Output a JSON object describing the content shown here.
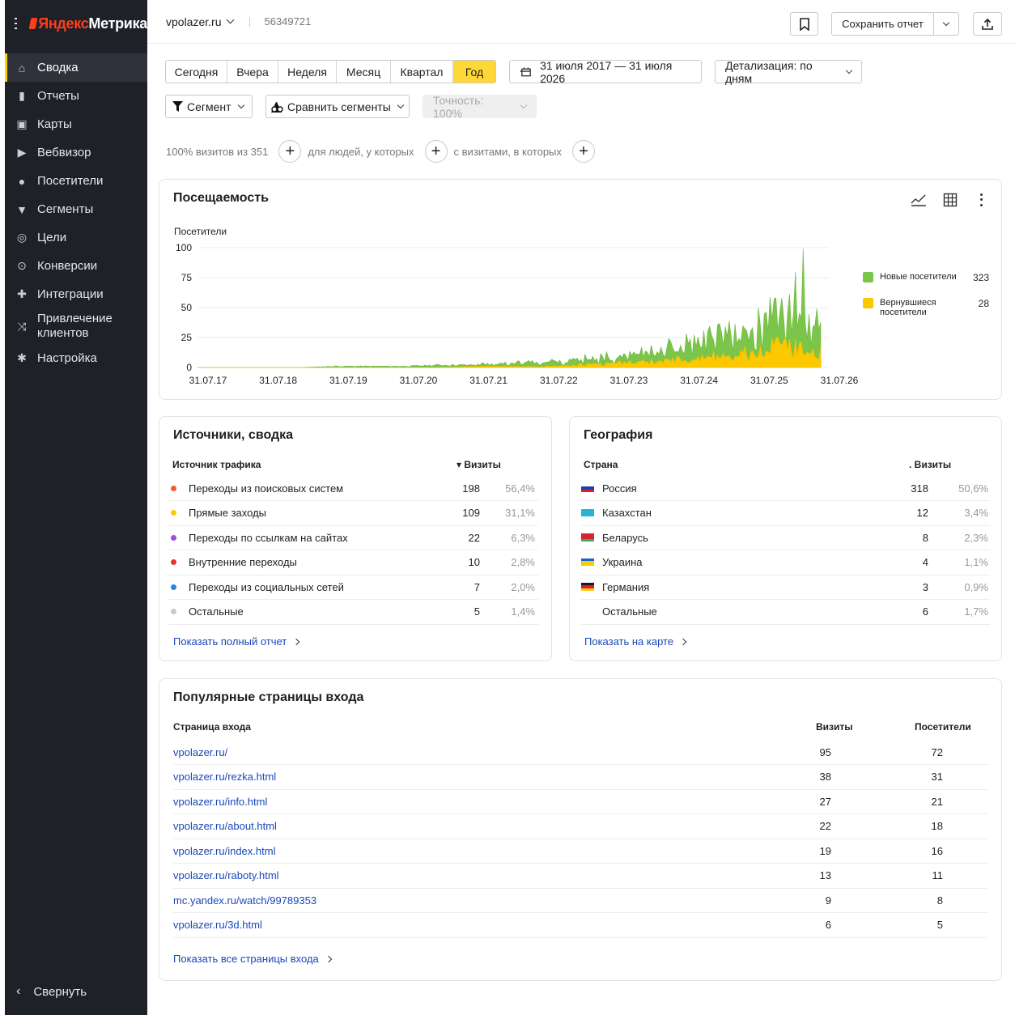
{
  "app": {
    "logo_ya": "Яндекс",
    "logo_rest": " Метрика"
  },
  "sidebar": {
    "items": [
      {
        "label": "Сводка",
        "icon": "home-icon",
        "active": true
      },
      {
        "label": "Отчеты",
        "icon": "bar-chart-icon"
      },
      {
        "label": "Карты",
        "icon": "map-icon"
      },
      {
        "label": "Вебвизор",
        "icon": "play-icon"
      },
      {
        "label": "Посетители",
        "icon": "user-icon"
      },
      {
        "label": "Сегменты",
        "icon": "funnel-icon"
      },
      {
        "label": "Цели",
        "icon": "target-icon"
      },
      {
        "label": "Конверсии",
        "icon": "conversion-icon"
      },
      {
        "label": "Интеграции",
        "icon": "puzzle-icon"
      },
      {
        "label": "Привлечение клиентов",
        "icon": "share-icon"
      },
      {
        "label": "Настройка",
        "icon": "gear-icon"
      }
    ],
    "collapse_label": "Свернуть"
  },
  "header": {
    "site": "vpolazer.ru",
    "counter_id": "56349721",
    "save_report": "Сохранить отчет"
  },
  "toolbar": {
    "periods": [
      "Сегодня",
      "Вчера",
      "Неделя",
      "Месяц",
      "Квартал",
      "Год"
    ],
    "active_period": "Год",
    "date_range": "31 июля 2017 — 31 июля 2026",
    "detail": "Детализация: по дням",
    "segment": "Сегмент",
    "compare": "Сравнить сегменты",
    "accuracy": "Точность: 100%"
  },
  "filters": {
    "visits_text": "100% визитов из 351",
    "people_text": "для людей, у которых",
    "visits_with_text": "с визитами, в которых"
  },
  "traffic": {
    "title": "Посещаемость",
    "ylabel": "Посетители",
    "legend": [
      {
        "name": "Новые посетители",
        "value": "323",
        "color": "#7bc54a"
      },
      {
        "name": "Вернувшиеся посетители",
        "value": "28",
        "color": "#fcc800"
      }
    ]
  },
  "chart_data": {
    "type": "area",
    "title": "Посещаемость",
    "ylabel": "Посетители",
    "ylim": [
      0,
      100
    ],
    "yticks": [
      0,
      25,
      50,
      75,
      100
    ],
    "xticks": [
      "31.07.17",
      "31.07.18",
      "31.07.19",
      "31.07.20",
      "31.07.21",
      "31.07.22",
      "31.07.23",
      "31.07.24",
      "31.07.25",
      "31.07.26"
    ],
    "stacked": false,
    "x": [
      "31.07.17",
      "31.12.17",
      "31.07.18",
      "31.12.18",
      "31.07.19",
      "31.12.19",
      "31.07.20",
      "31.12.20",
      "31.07.21",
      "31.12.21",
      "31.07.22",
      "31.12.22",
      "31.07.23",
      "31.12.23",
      "31.07.24",
      "31.12.24",
      "31.07.25",
      "31.12.25",
      "31.07.26"
    ],
    "series": [
      {
        "name": "Новые посетители",
        "color": "#7bc54a",
        "values": [
          0,
          0,
          0,
          0,
          1,
          1,
          1,
          2,
          2,
          3,
          4,
          5,
          8,
          11,
          15,
          20,
          25,
          45,
          25
        ]
      },
      {
        "name": "Вернувшиеся посетители",
        "color": "#fcc800",
        "values": [
          0,
          0,
          0,
          0,
          0,
          0,
          0,
          0,
          1,
          1,
          1,
          2,
          3,
          4,
          6,
          8,
          10,
          18,
          10
        ]
      }
    ]
  },
  "sources": {
    "title": "Источники, сводка",
    "col_source": "Источник трафика",
    "col_visits": "▾ Визиты",
    "rows": [
      {
        "name": "Переходы из поисковых систем",
        "visits": "198",
        "pct": "56,4%",
        "color": "#f55a2c"
      },
      {
        "name": "Прямые заходы",
        "visits": "109",
        "pct": "31,1%",
        "color": "#fcc800"
      },
      {
        "name": "Переходы по ссылкам на сайтах",
        "visits": "22",
        "pct": "6,3%",
        "color": "#a24be0"
      },
      {
        "name": "Внутренние переходы",
        "visits": "10",
        "pct": "2,8%",
        "color": "#e2362a"
      },
      {
        "name": "Переходы из социальных сетей",
        "visits": "7",
        "pct": "2,0%",
        "color": "#1e88e5"
      },
      {
        "name": "Остальные",
        "visits": "5",
        "pct": "1,4%",
        "color": "#c8c8c8"
      }
    ],
    "more": "Показать полный отчет"
  },
  "geo": {
    "title": "География",
    "col_country": "Страна",
    "col_visits": ". Визиты",
    "rows": [
      {
        "name": "Россия",
        "visits": "318",
        "pct": "50,6%",
        "flag": [
          "#ffffff",
          "#1c3fae",
          "#d8232a"
        ]
      },
      {
        "name": "Казахстан",
        "visits": "12",
        "pct": "3,4%",
        "flag": [
          "#28b4d8",
          "#28b4d8",
          "#28b4d8"
        ]
      },
      {
        "name": "Беларусь",
        "visits": "8",
        "pct": "2,3%",
        "flag": [
          "#d22730",
          "#d22730",
          "#4aa657"
        ]
      },
      {
        "name": "Украина",
        "visits": "4",
        "pct": "1,1%",
        "flag": [
          "#1f5fd1",
          "#f2d200",
          "#f2d200"
        ]
      },
      {
        "name": "Германия",
        "visits": "3",
        "pct": "0,9%",
        "flag": [
          "#1a1a1a",
          "#dd1f26",
          "#f7cf1a"
        ]
      },
      {
        "name": "Остальные",
        "visits": "6",
        "pct": "1,7%",
        "flag": null
      }
    ],
    "more": "Показать на карте"
  },
  "pages": {
    "title": "Популярные страницы входа",
    "col_page": "Страница входа",
    "col_visits": "Визиты",
    "col_visitors": "Посетители",
    "rows": [
      {
        "url": "vpolazer.ru/",
        "visits": "95",
        "visitors": "72"
      },
      {
        "url": "vpolazer.ru/rezka.html",
        "visits": "38",
        "visitors": "31"
      },
      {
        "url": "vpolazer.ru/info.html",
        "visits": "27",
        "visitors": "21"
      },
      {
        "url": "vpolazer.ru/about.html",
        "visits": "22",
        "visitors": "18"
      },
      {
        "url": "vpolazer.ru/index.html",
        "visits": "19",
        "visitors": "16"
      },
      {
        "url": "vpolazer.ru/raboty.html",
        "visits": "13",
        "visitors": "11"
      },
      {
        "url": "mc.yandex.ru/watch/99789353",
        "visits": "9",
        "visitors": "8"
      },
      {
        "url": "vpolazer.ru/3d.html",
        "visits": "6",
        "visitors": "5"
      }
    ],
    "more": "Показать все страницы входа"
  }
}
